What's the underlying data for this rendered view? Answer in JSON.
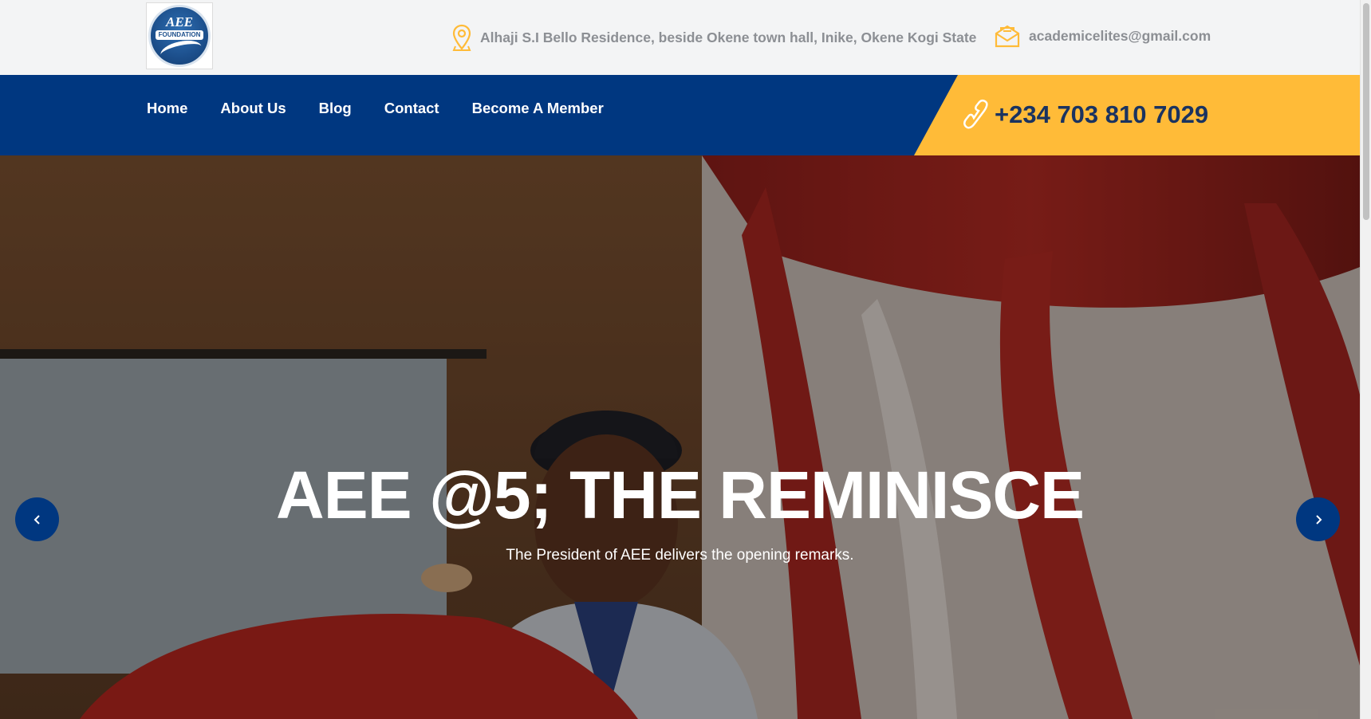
{
  "brand": {
    "logo_text": "AEE",
    "logo_band": "FOUNDATION"
  },
  "topbar": {
    "address": "Alhaji S.I Bello Residence, beside Okene town hall, Inike, Okene Kogi State",
    "email": "academicelites@gmail.com",
    "address_icon": "location-pin-icon",
    "email_icon": "envelope-icon"
  },
  "nav": {
    "items": [
      {
        "label": "Home"
      },
      {
        "label": "About Us"
      },
      {
        "label": "Blog"
      },
      {
        "label": "Contact"
      },
      {
        "label": "Become A Member"
      }
    ],
    "phone": "+234 703 810 7029",
    "phone_icon": "phone-icon"
  },
  "hero": {
    "title": "AEE @5; THE REMINISCE",
    "subtitle": "The President of AEE delivers the opening remarks.",
    "prev_icon": "chevron-left-icon",
    "next_icon": "chevron-right-icon"
  },
  "colors": {
    "navy": "#003780",
    "accent": "#ffbb38",
    "muted_text": "#8c8f94",
    "topbar_bg": "#f3f4f5"
  }
}
